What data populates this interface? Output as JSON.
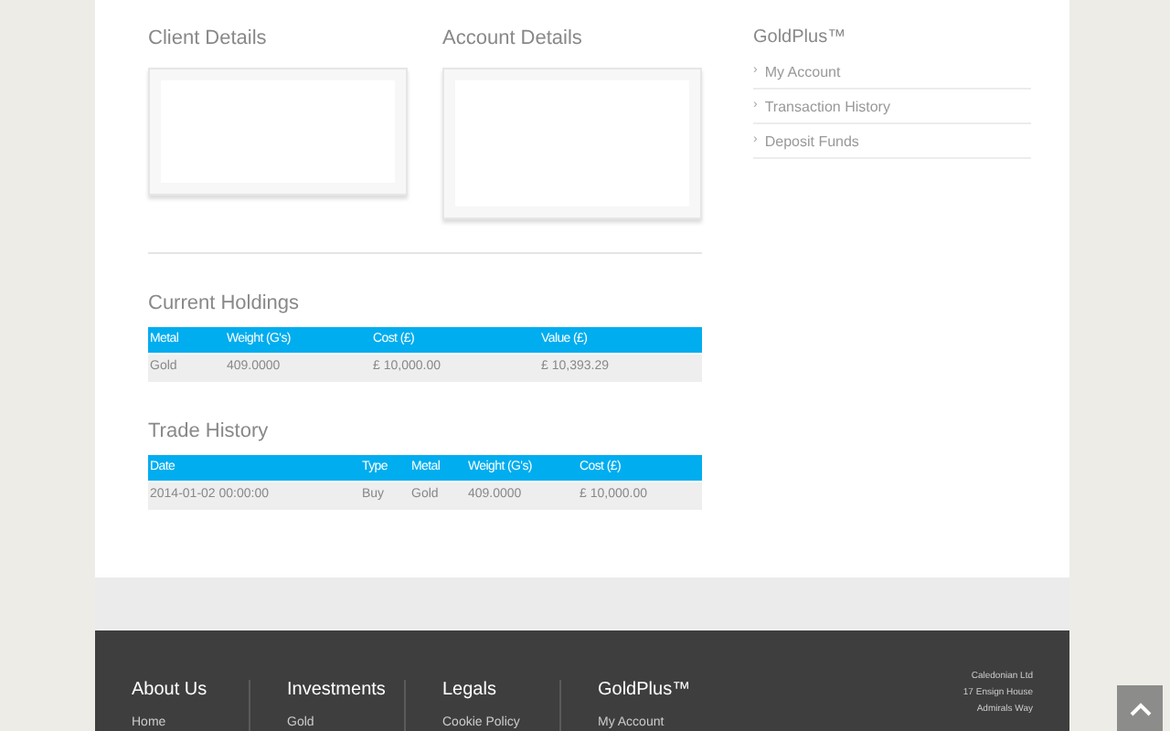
{
  "panels": [
    {
      "title": "Client Details"
    },
    {
      "title": "Account Details"
    }
  ],
  "sidebar": {
    "title": "GoldPlus™",
    "items": [
      {
        "marker": "›",
        "label": "My Account"
      },
      {
        "marker": "›",
        "label": "Transaction History"
      },
      {
        "marker": "›",
        "label": "Deposit Funds"
      }
    ]
  },
  "holdings": {
    "title": "Current Holdings",
    "columns": [
      "Metal",
      "Weight (G's)",
      "Cost (£)",
      "Value (£)"
    ],
    "rows": [
      [
        "Gold",
        "409.0000",
        "£ 10,000.00",
        "£ 10,393.29"
      ]
    ]
  },
  "trades": {
    "title": "Trade History",
    "columns": [
      "Date",
      "Type",
      "Metal",
      "Weight (G's)",
      "Cost (£)"
    ],
    "rows": [
      [
        "2014-01-02 00:00:00",
        "Buy",
        "Gold",
        "409.0000",
        "£ 10,000.00"
      ]
    ]
  },
  "footer": {
    "columns": [
      {
        "title": "About Us",
        "link": "Home"
      },
      {
        "title": "Investments",
        "link": "Gold"
      },
      {
        "title": "Legals",
        "link": "Cookie Policy"
      },
      {
        "title": "GoldPlus™",
        "link": "My Account"
      }
    ],
    "address": [
      "Caledonian Ltd",
      "17 Ensign House",
      "Admirals Way"
    ]
  }
}
